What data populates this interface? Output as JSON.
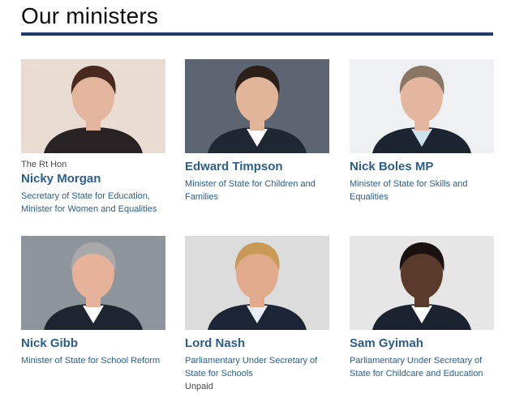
{
  "page": {
    "title": "Our ministers"
  },
  "ministers": [
    {
      "honorific": "The Rt Hon",
      "name": "Nicky Morgan",
      "role": "Secretary of State for Education, Minister for Women and Equalities",
      "note": "",
      "photo": {
        "bg": "#e8dcd3",
        "suit": "#2a2326",
        "skin": "#e2b59c",
        "hair": "#4a2a1e",
        "shirt": "#2a2326"
      }
    },
    {
      "honorific": "",
      "name": "Edward Timpson",
      "role": "Minister of State for Children and Families",
      "note": "",
      "photo": {
        "bg": "#5d6472",
        "suit": "#1f2733",
        "skin": "#e0b598",
        "hair": "#2b1f18",
        "shirt": "#ffffff"
      }
    },
    {
      "honorific": "",
      "name": "Nick Boles MP",
      "role": "Minister of State for Skills and Equalities",
      "note": "",
      "photo": {
        "bg": "#eef0f2",
        "suit": "#1c2430",
        "skin": "#e4b69f",
        "hair": "#8a7663",
        "shirt": "#cfe0ef"
      }
    },
    {
      "honorific": "",
      "name": "Nick Gibb",
      "role": "Minister of State for School Reform",
      "note": "",
      "photo": {
        "bg": "#8d949b",
        "suit": "#1e2530",
        "skin": "#e6b39a",
        "hair": "#a9a9a9",
        "shirt": "#ffffff"
      }
    },
    {
      "honorific": "",
      "name": "Lord Nash",
      "role": "Parliamentary Under Secretary of State for Schools",
      "note": "Unpaid",
      "photo": {
        "bg": "#dcdcdc",
        "suit": "#1b2535",
        "skin": "#e2aa8c",
        "hair": "#c99a55",
        "shirt": "#e8eef5"
      }
    },
    {
      "honorific": "",
      "name": "Sam Gyimah",
      "role": "Parliamentary Under Secretary of State for Childcare and Education",
      "note": "",
      "photo": {
        "bg": "#e6e6e6",
        "suit": "#1c2230",
        "skin": "#5a3a2a",
        "hair": "#1a1210",
        "shirt": "#ffffff"
      }
    }
  ]
}
